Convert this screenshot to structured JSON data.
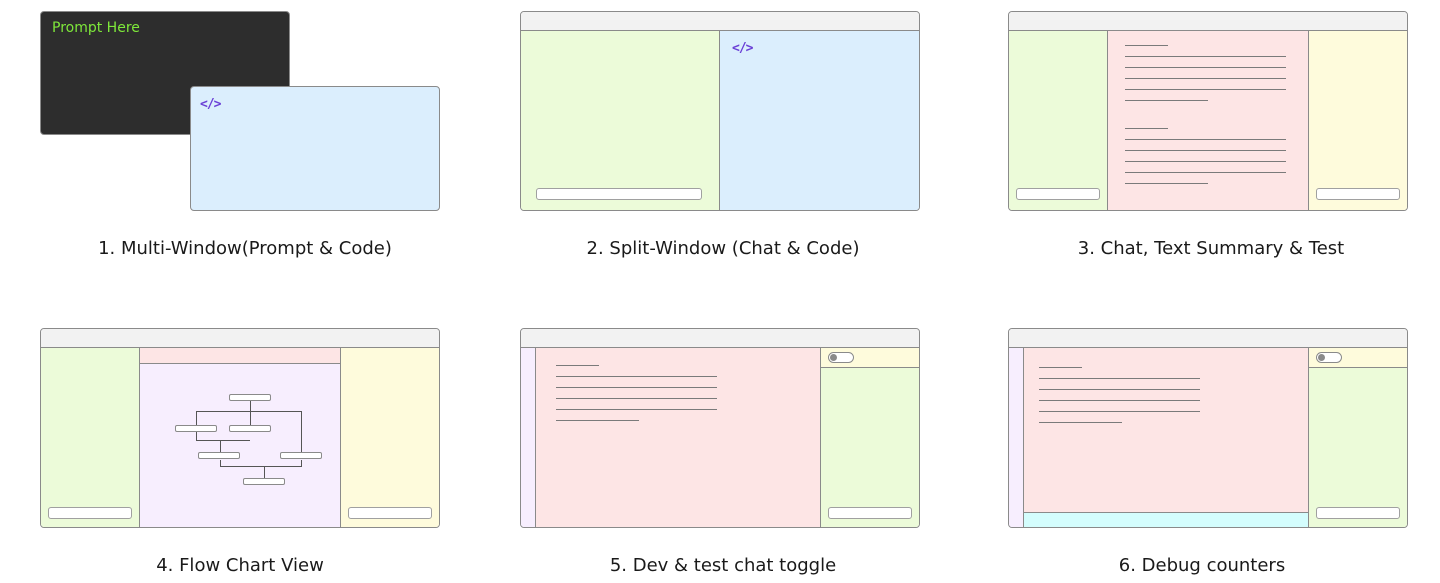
{
  "captions": {
    "c1": "1. Multi-Window(Prompt & Code)",
    "c2": "2. Split-Window (Chat & Code)",
    "c3": "3. Chat, Text Summary & Test",
    "c4": "4. Flow Chart View",
    "c5": "5. Dev & test chat  toggle",
    "c6": "6. Debug counters"
  },
  "panel1": {
    "prompt_label": "Prompt Here",
    "code_icon": "</>"
  },
  "panel2": {
    "code_icon": "</>"
  },
  "colors": {
    "dark": "#2d2d2d",
    "prompt_text": "#7ee83a",
    "code_blue": "#dbeefd",
    "chat_green": "#ecfbd9",
    "summary_pink": "#fde5e5",
    "test_yellow": "#fefbdc",
    "flow_purple": "#f7eefe",
    "debug_cyan": "#d4fdfd",
    "code_icon": "#6a3fd6"
  },
  "icons": [
    "code-icon",
    "toggle-switch-icon"
  ]
}
